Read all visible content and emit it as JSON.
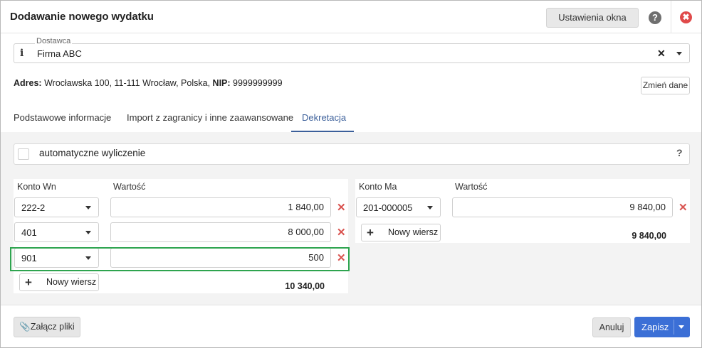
{
  "header": {
    "title": "Dodawanie nowego wydatku",
    "settings_label": "Ustawienia okna",
    "help_glyph": "?",
    "close_glyph": "✖"
  },
  "supplier": {
    "label": "Dostawca",
    "value": "Firma ABC",
    "clear_glyph": "✕"
  },
  "address": {
    "address_label": "Adres:",
    "address_value": "Wrocławska 100, 11-111 Wrocław, Polska,",
    "nip_label": "NIP:",
    "nip_value": "9999999999",
    "change_label": "Zmień dane"
  },
  "tabs": [
    {
      "label": "Podstawowe informacje",
      "active": false
    },
    {
      "label": "Import z zagranicy i inne zaawansowane",
      "active": false
    },
    {
      "label": "Dekretacja",
      "active": true
    }
  ],
  "auto_calc": {
    "label": "automatyczne wyliczenie",
    "checked": false,
    "help_glyph": "?"
  },
  "debit": {
    "account_header": "Konto Wn",
    "value_header": "Wartość",
    "rows": [
      {
        "account": "222-2",
        "value": "1 840,00"
      },
      {
        "account": "401",
        "value": "8 000,00"
      },
      {
        "account": "901",
        "value": "500"
      }
    ],
    "new_row_label": "Nowy wiersz",
    "total": "10 340,00"
  },
  "credit": {
    "account_header": "Konto Ma",
    "value_header": "Wartość",
    "rows": [
      {
        "account": "201-000005",
        "value": "9 840,00"
      }
    ],
    "new_row_label": "Nowy wiersz",
    "total": "9 840,00"
  },
  "footer": {
    "attach_label": "Załącz pliki",
    "cancel_label": "Anuluj",
    "save_label": "Zapisz"
  },
  "colors": {
    "accent": "#3b6fd6",
    "tab_active": "#3b5f9a",
    "delete": "#d9534f",
    "highlight": "#2ea44f",
    "close": "#e04a4a"
  }
}
